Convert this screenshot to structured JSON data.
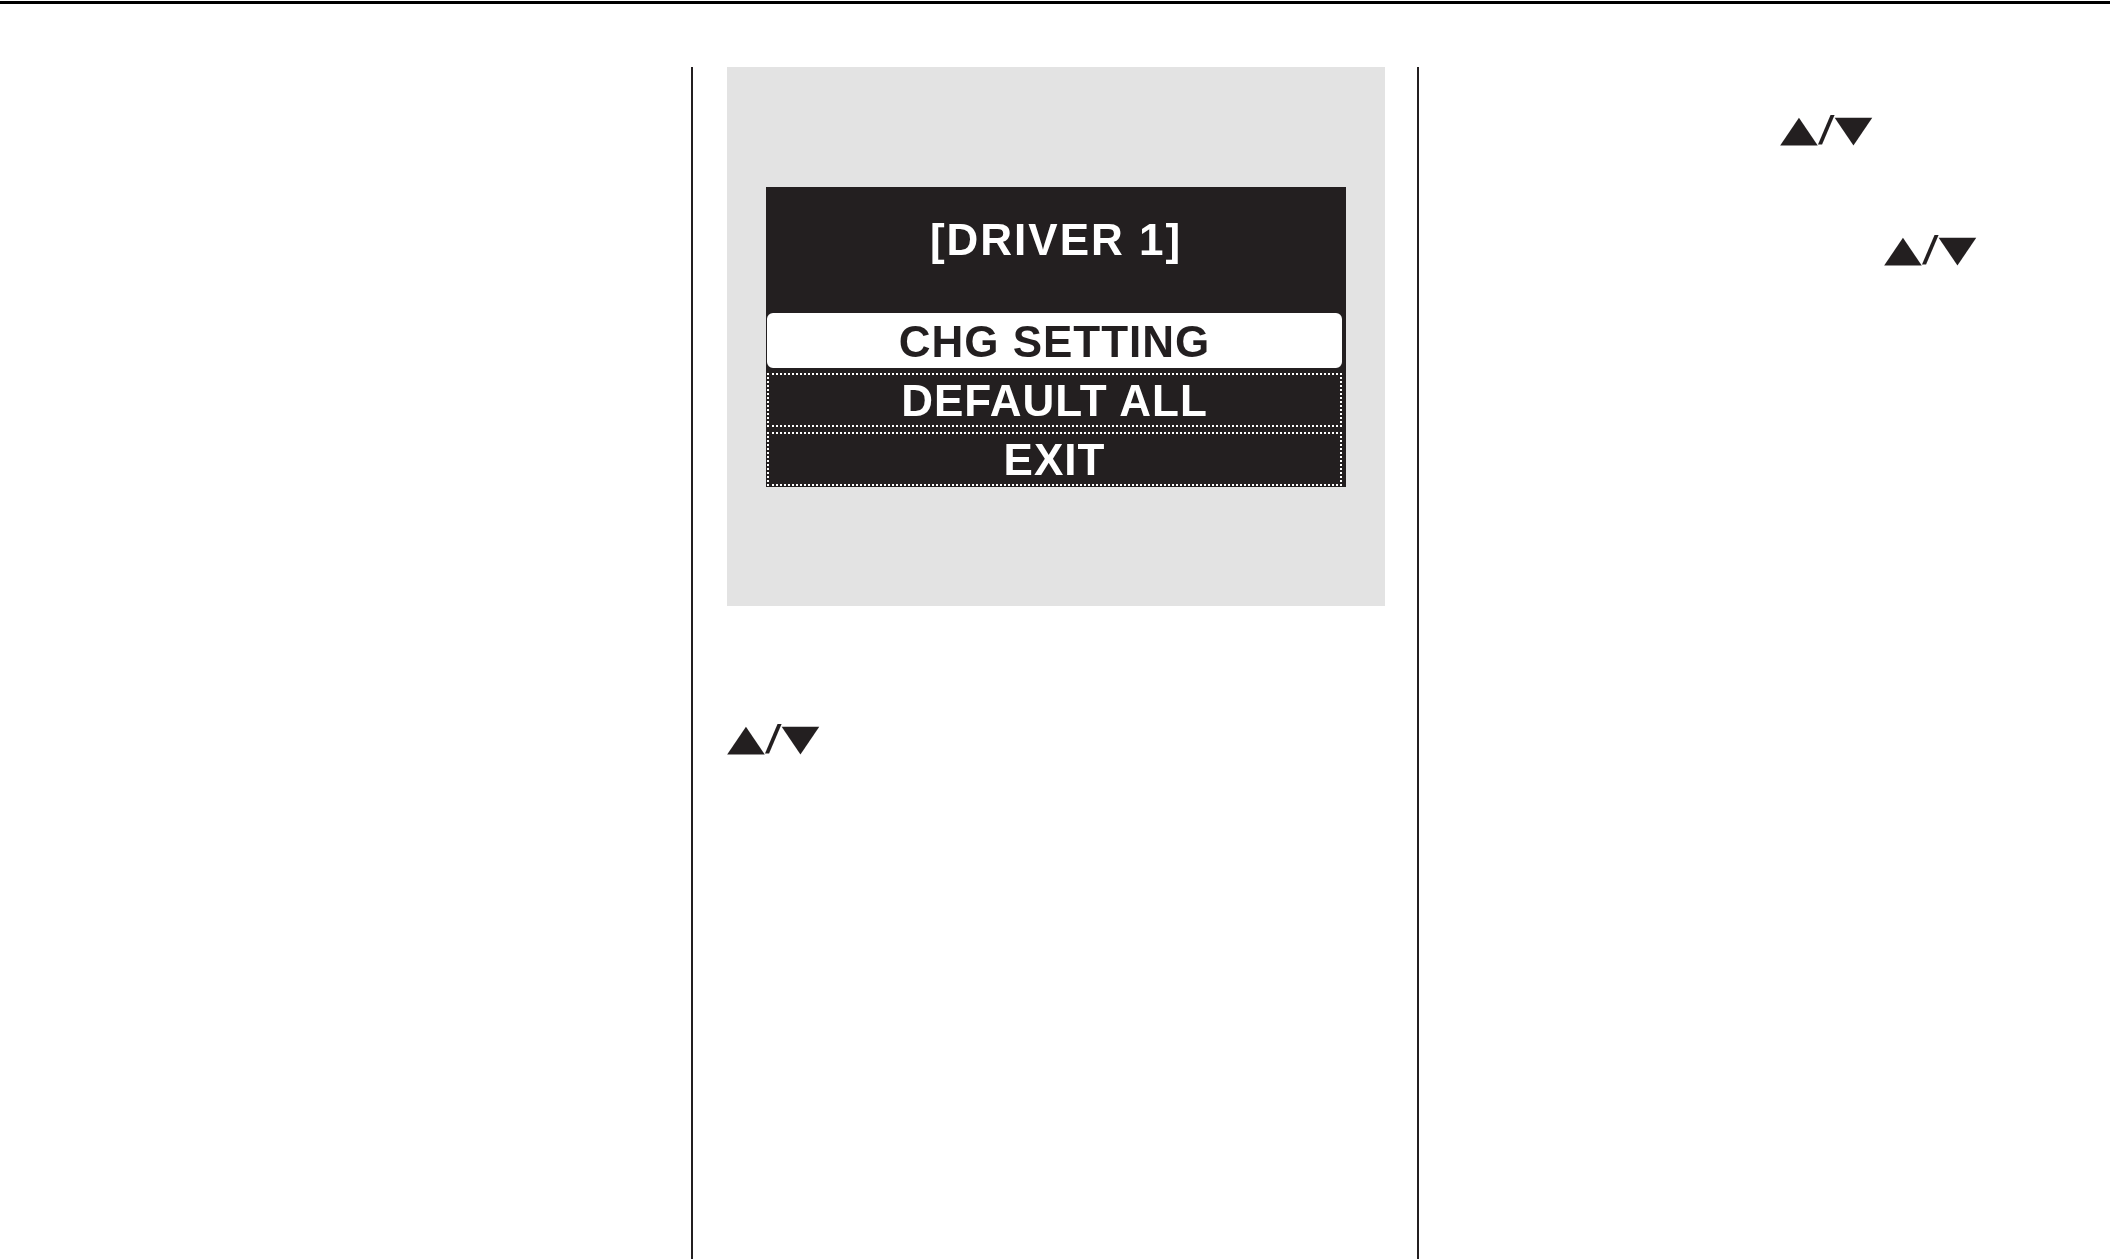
{
  "center_column": {
    "display_illustration": {
      "screen": {
        "title": "[DRIVER 1]",
        "menu": [
          {
            "label": "CHG SETTING",
            "selected": true
          },
          {
            "label": "DEFAULT ALL",
            "selected": false
          },
          {
            "label": "EXIT",
            "selected": false
          }
        ]
      }
    },
    "button_symbols": "▲/▼"
  },
  "right_column": {
    "button_symbols": [
      "▲/▼",
      "▲/▼"
    ]
  }
}
